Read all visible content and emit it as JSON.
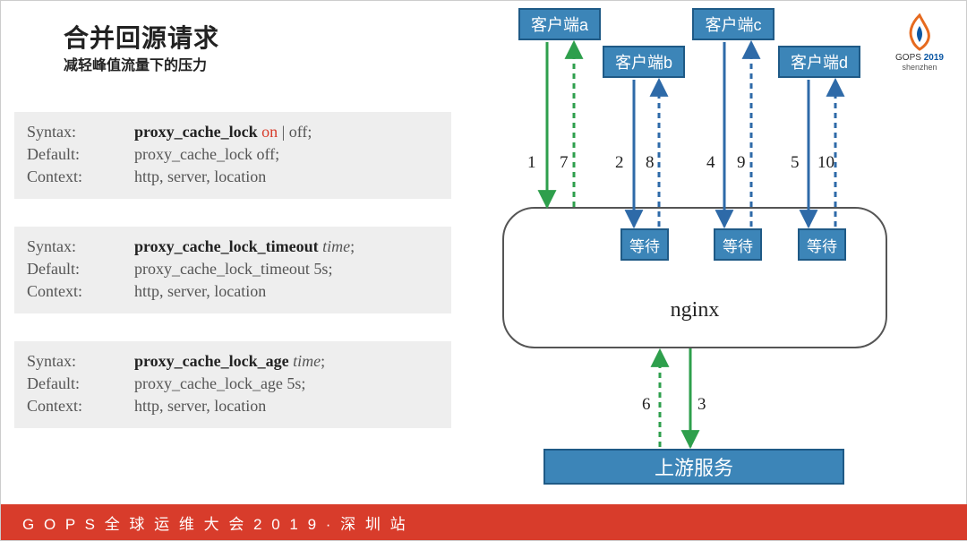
{
  "title": {
    "main": "合并回源请求",
    "sub": "减轻峰值流量下的压力"
  },
  "configs": [
    {
      "syntax": {
        "name": "proxy_cache_lock",
        "on": "on",
        "off": "| off;"
      },
      "default": "proxy_cache_lock off;",
      "context": "http, server, location"
    },
    {
      "syntax2": {
        "name": "proxy_cache_lock_timeout",
        "arg": "time"
      },
      "default": "proxy_cache_lock_timeout 5s;",
      "context": "http, server, location"
    },
    {
      "syntax2": {
        "name": "proxy_cache_lock_age",
        "arg": "time"
      },
      "default": "proxy_cache_lock_age 5s;",
      "context": "http, server, location"
    }
  ],
  "labels": {
    "syntax": "Syntax:",
    "default": "Default:",
    "context": "Context:"
  },
  "diagram": {
    "clients": {
      "a": "客户端a",
      "b": "客户端b",
      "c": "客户端c",
      "d": "客户端d"
    },
    "wait": "等待",
    "nginx": "nginx",
    "upstream": "上游服务",
    "nums": {
      "1": "1",
      "2": "2",
      "3": "3",
      "4": "4",
      "5": "5",
      "6": "6",
      "7": "7",
      "8": "8",
      "9": "9",
      "10": "10"
    }
  },
  "logo": {
    "line1a": "GOPS",
    "line1b": "2019",
    "line2": "shenzhen"
  },
  "footer": "G O P S  全 球 运 维 大 会 2 0 1 9 · 深 圳 站"
}
